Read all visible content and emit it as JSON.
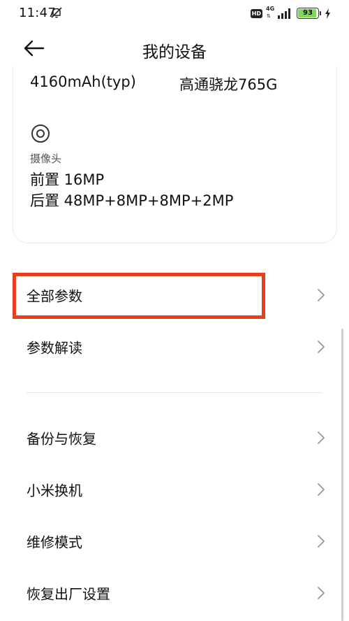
{
  "status_bar": {
    "time": "11:47",
    "hd_label": "HD",
    "network_label": "4G",
    "battery_level": "93",
    "battery_fraction": 0.93
  },
  "header": {
    "title": "我的设备"
  },
  "specs": {
    "battery_capacity": "4160mAh(typ)",
    "processor": "高通骁龙765G",
    "camera_label": "摄像头",
    "camera_front": "前置 16MP",
    "camera_rear": "后置 48MP+8MP+8MP+2MP"
  },
  "menu": {
    "group1": [
      {
        "label": "全部参数"
      },
      {
        "label": "参数解读"
      }
    ],
    "group2": [
      {
        "label": "备份与恢复"
      },
      {
        "label": "小米换机"
      },
      {
        "label": "维修模式"
      },
      {
        "label": "恢复出厂设置"
      }
    ]
  },
  "colors": {
    "highlight": "#e8401c",
    "battery_fill": "#7ed957"
  },
  "icons": {
    "back": "arrow-left-icon",
    "camera": "camera-lens-icon",
    "chevron": "chevron-right-icon",
    "mute": "notifications-off-icon",
    "charge": "charging-bolt-icon"
  }
}
